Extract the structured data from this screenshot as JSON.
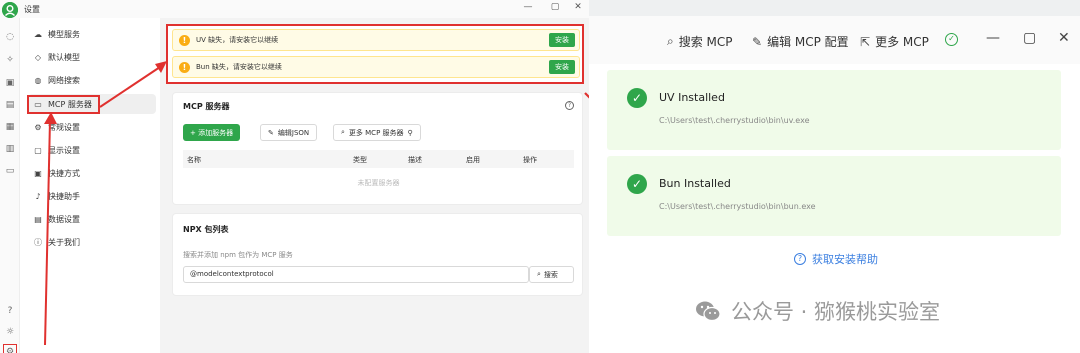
{
  "left_window": {
    "title": "设置",
    "avatar_letter": "♙",
    "controls": [
      "—",
      "▢",
      "✕"
    ],
    "nav_items": [
      {
        "icon": "cloud-icon",
        "label": "模型服务"
      },
      {
        "icon": "cube-icon",
        "label": "默认模型"
      },
      {
        "icon": "globe-icon",
        "label": "网络搜索"
      },
      {
        "icon": "terminal-icon",
        "label": "MCP 服务器"
      },
      {
        "icon": "gear-icon",
        "label": "常规设置"
      },
      {
        "icon": "monitor-icon",
        "label": "显示设置"
      },
      {
        "icon": "keyboard-icon",
        "label": "快捷方式"
      },
      {
        "icon": "mic-icon",
        "label": "快捷助手"
      },
      {
        "icon": "database-icon",
        "label": "数据设置"
      },
      {
        "icon": "info-icon",
        "label": "关于我们"
      }
    ],
    "warnings": [
      {
        "text": "UV 缺失，请安装它以继续",
        "button": "安装"
      },
      {
        "text": "Bun 缺失，请安装它以继续",
        "button": "安装"
      }
    ],
    "mcp_card": {
      "title": "MCP 服务器",
      "add_button": "+ 添加服务器",
      "edit_json_button": "编辑JSON",
      "more_button": "更多 MCP 服务器",
      "columns": [
        "名称",
        "类型",
        "描述",
        "启用",
        "操作"
      ],
      "empty_text": "未配置服务器"
    },
    "npx_card": {
      "title": "NPX 包列表",
      "hint": "搜索并添加 npm 包作为 MCP 服务",
      "search_value": "@modelcontextprotocol",
      "search_button": "搜索"
    }
  },
  "right_window": {
    "toolbar": {
      "search_mcp": "搜索 MCP",
      "edit_config": "编辑 MCP 配置",
      "more_mcp": "更多 MCP"
    },
    "installs": [
      {
        "title": "UV Installed",
        "path": "C:\\Users\\test\\.cherrystudio\\bin\\uv.exe"
      },
      {
        "title": "Bun Installed",
        "path": "C:\\Users\\test\\.cherrystudio\\bin\\bun.exe"
      }
    ],
    "help_link": "获取安装帮助",
    "watermark": "公众号 · 猕猴桃实验室"
  },
  "colors": {
    "accent_green": "#2fa64b",
    "highlight_red": "#e0312f",
    "warning_bg": "#fffbe6",
    "link_blue": "#3b7fe0"
  }
}
